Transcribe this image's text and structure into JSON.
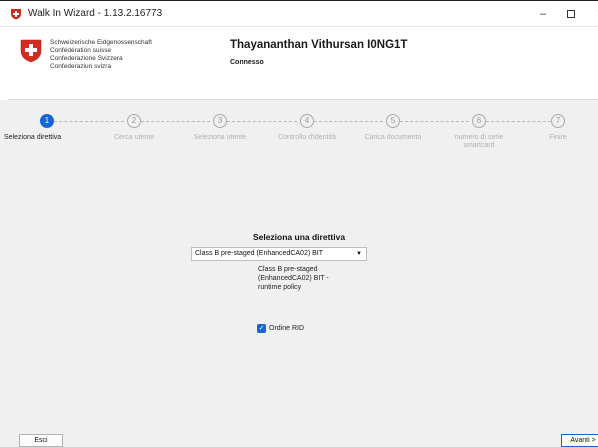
{
  "window": {
    "title": "Walk In Wizard - 1.13.2.16773",
    "controls": {
      "minimize": "–",
      "close": "✕"
    }
  },
  "header": {
    "confederation": [
      "Schweizerische Eidgenossenschaft",
      "Confédération suisse",
      "Confederazione Svizzera",
      "Confederaziun svizra"
    ],
    "user_name": "Thayananthan Vithursan I0NG1T",
    "status": "Connesso"
  },
  "steps": [
    {
      "number": "1",
      "label": "Seleziona direttiva",
      "active": true
    },
    {
      "number": "2",
      "label": "Cerca utente",
      "active": false
    },
    {
      "number": "3",
      "label": "Seleziona utente",
      "active": false
    },
    {
      "number": "4",
      "label": "Controllo d'identità",
      "active": false
    },
    {
      "number": "5",
      "label": "Carica documento",
      "active": false
    },
    {
      "number": "6",
      "label": "numero di serie smartcard",
      "active": false
    },
    {
      "number": "7",
      "label": "Finire",
      "active": false
    }
  ],
  "directive": {
    "heading": "Seleziona una direttiva",
    "selected": "Class B pre-staged (EnhancedCA02) BIT",
    "description": "Class B pre-staged (EnhancedCA02) BIT - runtime policy",
    "checkbox_label": "Ordine RID",
    "checkbox_checked": true
  },
  "footer": {
    "exit_label": "Esci",
    "next_label": "Avanti >"
  },
  "colors": {
    "accent": "#1565d8",
    "swiss_red": "#d52b1e"
  }
}
